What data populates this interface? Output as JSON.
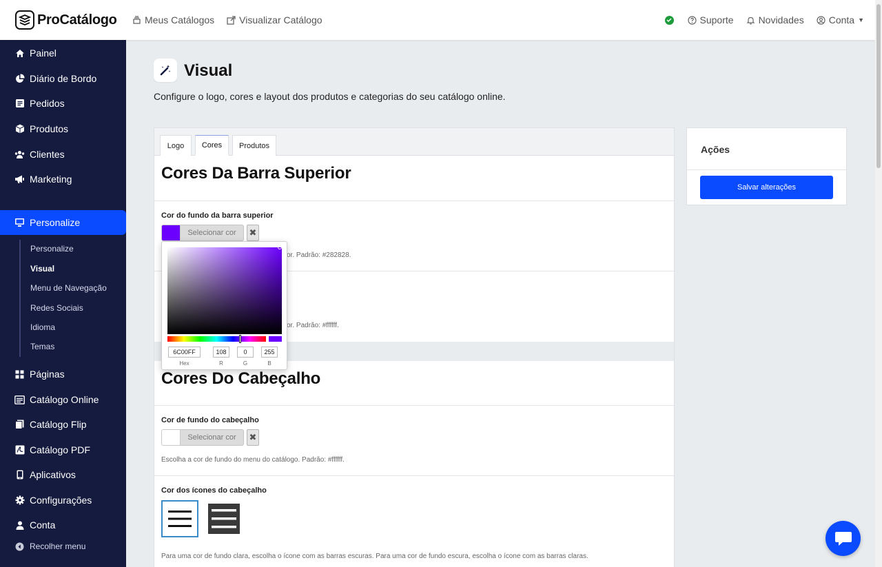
{
  "brand": {
    "name": "ProCatálogo"
  },
  "topnav": {
    "catalogs": "Meus Catálogos",
    "view": "Visualizar Catálogo"
  },
  "topright": {
    "support": "Suporte",
    "news": "Novidades",
    "account": "Conta"
  },
  "sidebar": {
    "items": [
      {
        "label": "Painel"
      },
      {
        "label": "Diário de Bordo"
      },
      {
        "label": "Pedidos"
      },
      {
        "label": "Produtos"
      },
      {
        "label": "Clientes"
      },
      {
        "label": "Marketing"
      },
      {
        "label": "Personalize"
      },
      {
        "label": "Páginas"
      },
      {
        "label": "Catálogo Online"
      },
      {
        "label": "Catálogo Flip"
      },
      {
        "label": "Catálogo PDF"
      },
      {
        "label": "Aplicativos"
      },
      {
        "label": "Configurações"
      },
      {
        "label": "Conta"
      }
    ],
    "sub": [
      {
        "label": "Personalize"
      },
      {
        "label": "Visual"
      },
      {
        "label": "Menu de Navegação"
      },
      {
        "label": "Redes Sociais"
      },
      {
        "label": "Idioma"
      },
      {
        "label": "Temas"
      }
    ],
    "collapse": "Recolher menu"
  },
  "page": {
    "title": "Visual",
    "description": "Configure o logo, cores e layout dos produtos e categorias do seu catálogo online."
  },
  "tabs": [
    {
      "label": "Logo"
    },
    {
      "label": "Cores"
    },
    {
      "label": "Produtos"
    }
  ],
  "sections": {
    "topbar_title": "Cores Da Barra Superior",
    "topbar_bg_label": "Cor do fundo da barra superior",
    "topbar_bg_hint_tail": "or. Padrão: #282828.",
    "topbar_text_hint_tail": "or. Padrão: #ffffff.",
    "header_title": "Cores Do Cabeçalho",
    "header_bg_label": "Cor de fundo do cabeçalho",
    "header_bg_hint": "Escolha a cor de fundo do menu do catálogo. Padrão: #ffffff.",
    "header_icons_label": "Cor dos ícones do cabeçalho",
    "header_icons_hint": "Para uma cor de fundo clara, escolha o ícone com as barras escuras. Para uma cor de fundo escura, escolha o ícone com as barras claras.",
    "select_color": "Selecionar cor",
    "clear": "✖"
  },
  "colors": {
    "accent": "#0a4bff",
    "sidebar": "#151b3f",
    "picked": "#6c00ff"
  },
  "picker": {
    "hex": "6C00FF",
    "r": "108",
    "g": "0",
    "b": "255",
    "hex_label": "Hex",
    "r_label": "R",
    "g_label": "G",
    "b_label": "B"
  },
  "actions": {
    "title": "Ações",
    "save": "Salvar alterações"
  }
}
